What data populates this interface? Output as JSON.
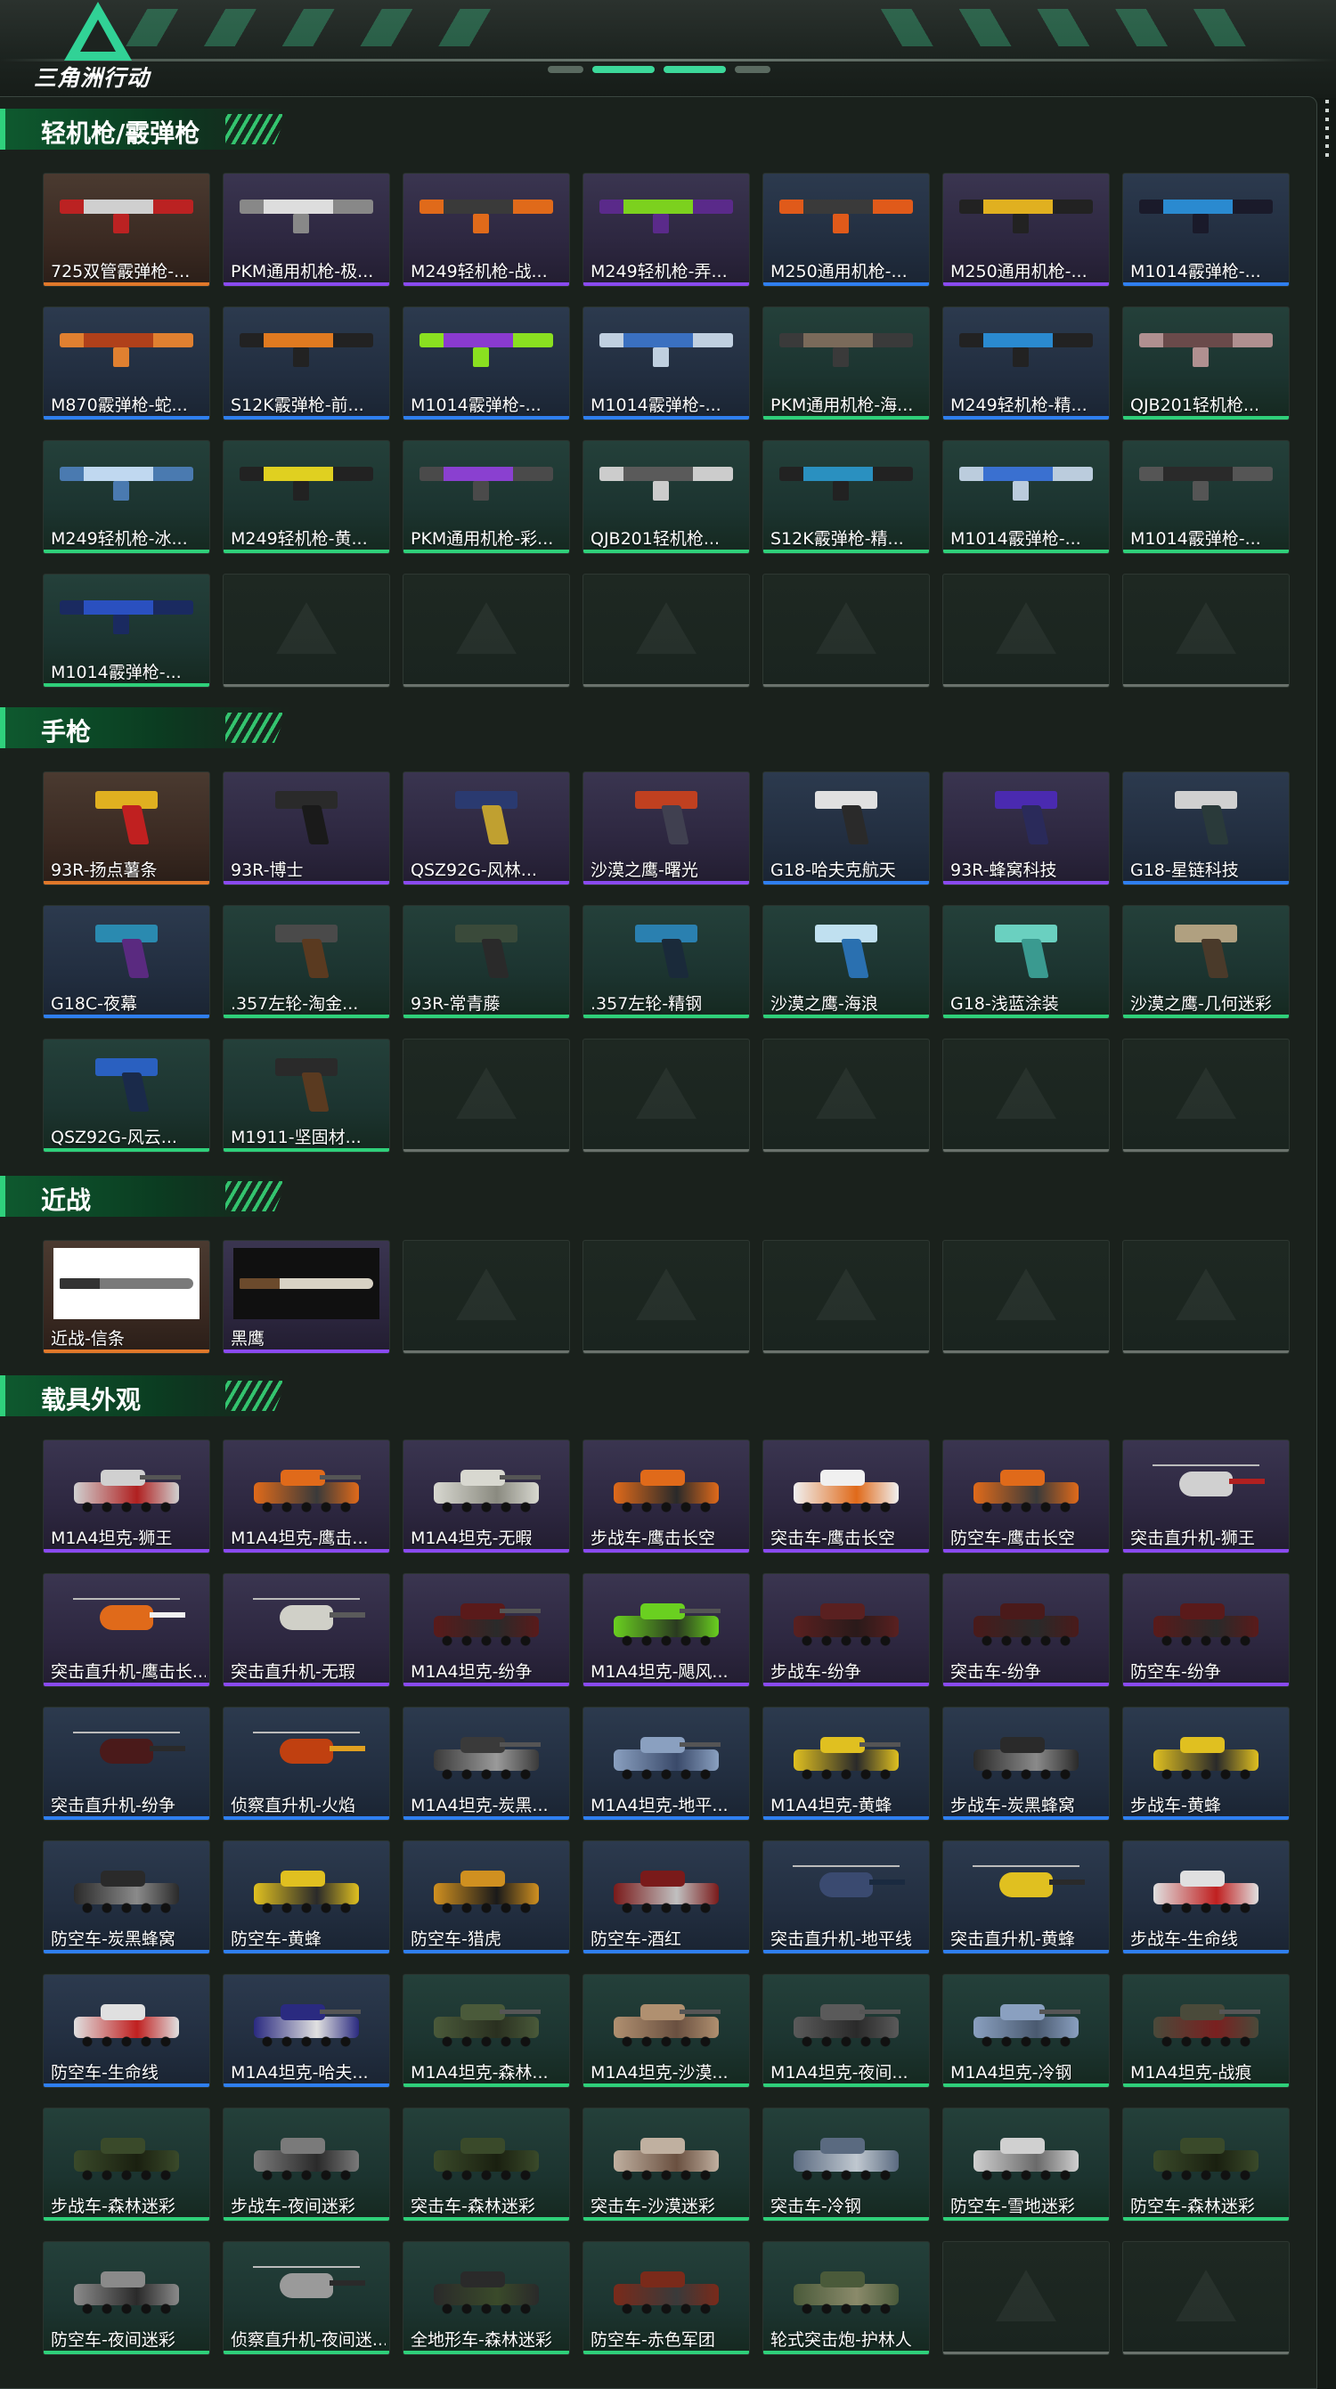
{
  "logo": {
    "text": "三角洲行动"
  },
  "sections": [
    {
      "title": "轻机枪/霰弹枪",
      "items": [
        {
          "label": "725双管霰弹枪-...",
          "quality": "orange",
          "kind": "gun",
          "c1": "#cfcfcf",
          "c2": "#b22"
        },
        {
          "label": "PKM通用机枪-极...",
          "quality": "purple",
          "kind": "gun",
          "c1": "#ddd",
          "c2": "#888"
        },
        {
          "label": "M249轻机枪-战...",
          "quality": "purple",
          "kind": "gun",
          "c1": "#3a3a3a",
          "c2": "#e06a1a"
        },
        {
          "label": "M249轻机枪-弄...",
          "quality": "purple",
          "kind": "gun",
          "c1": "#7cd11e",
          "c2": "#5a2a8a"
        },
        {
          "label": "M250通用机枪-...",
          "quality": "blue",
          "kind": "gun",
          "c1": "#3a3a3a",
          "c2": "#e05a1a"
        },
        {
          "label": "M250通用机枪-...",
          "quality": "purple",
          "kind": "gun",
          "c1": "#e0b020",
          "c2": "#222"
        },
        {
          "label": "M1014霰弹枪-...",
          "quality": "blue",
          "kind": "gun",
          "c1": "#2a8ad0",
          "c2": "#1a1a2a"
        },
        {
          "label": "M870霰弹枪-蛇...",
          "quality": "blue",
          "kind": "gun",
          "c1": "#b0401a",
          "c2": "#e08030"
        },
        {
          "label": "S12K霰弹枪-前...",
          "quality": "blue",
          "kind": "gun",
          "c1": "#e07a20",
          "c2": "#222"
        },
        {
          "label": "M1014霰弹枪-...",
          "quality": "blue",
          "kind": "gun",
          "c1": "#8a3ad0",
          "c2": "#8ae020"
        },
        {
          "label": "M1014霰弹枪-...",
          "quality": "blue",
          "kind": "gun",
          "c1": "#3a70c0",
          "c2": "#c0d0e0"
        },
        {
          "label": "PKM通用机枪-海...",
          "quality": "green",
          "kind": "gun",
          "c1": "#7a6a5a",
          "c2": "#3a3a3a"
        },
        {
          "label": "M249轻机枪-精...",
          "quality": "blue",
          "kind": "gun",
          "c1": "#2a8ad0",
          "c2": "#222"
        },
        {
          "label": "QJB201轻机枪...",
          "quality": "green",
          "kind": "gun",
          "c1": "#6a4a4a",
          "c2": "#b09090"
        },
        {
          "label": "M249轻机枪-冰...",
          "quality": "green",
          "kind": "gun",
          "c1": "#c0d8f0",
          "c2": "#4a7ab0"
        },
        {
          "label": "M249轻机枪-黄...",
          "quality": "green",
          "kind": "gun",
          "c1": "#e0d020",
          "c2": "#222"
        },
        {
          "label": "PKM通用机枪-彩...",
          "quality": "green",
          "kind": "gun",
          "c1": "#8a40d0",
          "c2": "#4a4a4a"
        },
        {
          "label": "QJB201轻机枪...",
          "quality": "green",
          "kind": "gun",
          "c1": "#5a5a5a",
          "c2": "#ccc"
        },
        {
          "label": "S12K霰弹枪-精...",
          "quality": "green",
          "kind": "gun",
          "c1": "#2a90c0",
          "c2": "#222"
        },
        {
          "label": "M1014霰弹枪-...",
          "quality": "green",
          "kind": "gun",
          "c1": "#3a70d0",
          "c2": "#bcd"
        },
        {
          "label": "M1014霰弹枪-...",
          "quality": "green",
          "kind": "gun",
          "c1": "#2a2a2a",
          "c2": "#555"
        },
        {
          "label": "M1014霰弹枪-...",
          "quality": "green",
          "kind": "gun",
          "c1": "#2a50c0",
          "c2": "#1a2a60"
        }
      ],
      "empty": 6
    },
    {
      "title": "手枪",
      "items": [
        {
          "label": "93R-扬点薯条",
          "quality": "orange",
          "kind": "pistol",
          "c1": "#e0b020",
          "c2": "#c02020"
        },
        {
          "label": "93R-博士",
          "quality": "purple",
          "kind": "pistol",
          "c1": "#2a2a2a",
          "c2": "#1a1a1a"
        },
        {
          "label": "QSZ92G-风林...",
          "quality": "purple",
          "kind": "pistol",
          "c1": "#2a3a70",
          "c2": "#c0a030"
        },
        {
          "label": "沙漠之鹰-曙光",
          "quality": "purple",
          "kind": "pistol",
          "c1": "#c04020",
          "c2": "#404050"
        },
        {
          "label": "G18-哈夫克航天",
          "quality": "blue",
          "kind": "pistol",
          "c1": "#e0e0e0",
          "c2": "#2a2a2a"
        },
        {
          "label": "93R-蜂窝科技",
          "quality": "purple",
          "kind": "pistol",
          "c1": "#4a2ab0",
          "c2": "#2a2a5a"
        },
        {
          "label": "G18-星链科技",
          "quality": "blue",
          "kind": "pistol",
          "c1": "#d0d0d0",
          "c2": "#2a3a3a"
        },
        {
          "label": "G18C-夜幕",
          "quality": "blue",
          "kind": "pistol",
          "c1": "#2a8ab0",
          "c2": "#5a2a80"
        },
        {
          "label": ".357左轮-淘金...",
          "quality": "green",
          "kind": "pistol",
          "c1": "#4a4a4a",
          "c2": "#5a3a20"
        },
        {
          "label": "93R-常青藤",
          "quality": "green",
          "kind": "pistol",
          "c1": "#3a4a3a",
          "c2": "#2a2a2a"
        },
        {
          "label": ".357左轮-精钢",
          "quality": "green",
          "kind": "pistol",
          "c1": "#2a80b0",
          "c2": "#1a2a3a"
        },
        {
          "label": "沙漠之鹰-海浪",
          "quality": "green",
          "kind": "pistol",
          "c1": "#c0e0f0",
          "c2": "#2a70b0"
        },
        {
          "label": "G18-浅蓝涂装",
          "quality": "green",
          "kind": "pistol",
          "c1": "#6ad0c0",
          "c2": "#3a9a90"
        },
        {
          "label": "沙漠之鹰-几何迷彩",
          "quality": "green",
          "kind": "pistol",
          "c1": "#b0a080",
          "c2": "#4a3a2a"
        },
        {
          "label": "QSZ92G-风云...",
          "quality": "green",
          "kind": "pistol",
          "c1": "#2a60c0",
          "c2": "#1a2a4a"
        },
        {
          "label": "M1911-坚固材...",
          "quality": "green",
          "kind": "pistol",
          "c1": "#2a2a2a",
          "c2": "#5a3a20"
        }
      ],
      "empty": 5
    },
    {
      "title": "近战",
      "items": [
        {
          "label": "近战-信条",
          "quality": "orange",
          "kind": "knife-white",
          "c1": "#555",
          "c2": "#b22"
        },
        {
          "label": "黑鹰",
          "quality": "purple",
          "kind": "knife",
          "c1": "#d8d2c4",
          "c2": "#6b4a2c"
        }
      ],
      "empty": 5
    },
    {
      "title": "载具外观",
      "items": [
        {
          "label": "M1A4坦克-狮王",
          "quality": "purple",
          "kind": "tank",
          "c1": "#d0d0d0",
          "c2": "#b02020"
        },
        {
          "label": "M1A4坦克-鹰击...",
          "quality": "purple",
          "kind": "tank",
          "c1": "#e06a1a",
          "c2": "#3a3a3a"
        },
        {
          "label": "M1A4坦克-无暇",
          "quality": "purple",
          "kind": "tank",
          "c1": "#d8d8d0",
          "c2": "#8a8a80"
        },
        {
          "label": "步战车-鹰击长空",
          "quality": "purple",
          "kind": "apc",
          "c1": "#e06a1a",
          "c2": "#2a2a2a"
        },
        {
          "label": "突击车-鹰击长空",
          "quality": "purple",
          "kind": "car",
          "c1": "#f0f0f0",
          "c2": "#e06a1a"
        },
        {
          "label": "防空车-鹰击长空",
          "quality": "purple",
          "kind": "apc",
          "c1": "#e06a1a",
          "c2": "#3a3a3a"
        },
        {
          "label": "突击直升机-狮王",
          "quality": "purple",
          "kind": "heli",
          "c1": "#d0d0d0",
          "c2": "#b02020"
        },
        {
          "label": "突击直升机-鹰击长...",
          "quality": "purple",
          "kind": "heli",
          "c1": "#e06a1a",
          "c2": "#f0f0f0"
        },
        {
          "label": "突击直升机-无瑕",
          "quality": "purple",
          "kind": "heli",
          "c1": "#d0d0c8",
          "c2": "#5a5a5a"
        },
        {
          "label": "M1A4坦克-纷争",
          "quality": "purple",
          "kind": "tank",
          "c1": "#5a1a1a",
          "c2": "#2a2a2a"
        },
        {
          "label": "M1A4坦克-飓风...",
          "quality": "purple",
          "kind": "tank",
          "c1": "#6ad020",
          "c2": "#2a3a20"
        },
        {
          "label": "步战车-纷争",
          "quality": "purple",
          "kind": "apc",
          "c1": "#5a2020",
          "c2": "#2a1a1a"
        },
        {
          "label": "突击车-纷争",
          "quality": "purple",
          "kind": "car",
          "c1": "#4a1a1a",
          "c2": "#2a2a2a"
        },
        {
          "label": "防空车-纷争",
          "quality": "purple",
          "kind": "apc",
          "c1": "#5a1a1a",
          "c2": "#2a2a2a"
        },
        {
          "label": "突击直升机-纷争",
          "quality": "blue",
          "kind": "heli",
          "c1": "#4a1a1a",
          "c2": "#2a2a2a"
        },
        {
          "label": "侦察直升机-火焰",
          "quality": "blue",
          "kind": "heli",
          "c1": "#c04010",
          "c2": "#e0a020"
        },
        {
          "label": "M1A4坦克-炭黑...",
          "quality": "blue",
          "kind": "tank",
          "c1": "#3a3a3a",
          "c2": "#9a9a9a"
        },
        {
          "label": "M1A4坦克-地平...",
          "quality": "blue",
          "kind": "tank",
          "c1": "#8aa0c0",
          "c2": "#3a4a6a"
        },
        {
          "label": "M1A4坦克-黄蜂",
          "quality": "blue",
          "kind": "tank",
          "c1": "#e0c020",
          "c2": "#2a2a2a"
        },
        {
          "label": "步战车-炭黑蜂窝",
          "quality": "blue",
          "kind": "apc",
          "c1": "#2a2a2a",
          "c2": "#8a8a8a"
        },
        {
          "label": "步战车-黄蜂",
          "quality": "blue",
          "kind": "apc",
          "c1": "#e0c020",
          "c2": "#2a2a2a"
        },
        {
          "label": "防空车-炭黑蜂窝",
          "quality": "blue",
          "kind": "apc",
          "c1": "#2a2a2a",
          "c2": "#8a8a8a"
        },
        {
          "label": "防空车-黄蜂",
          "quality": "blue",
          "kind": "apc",
          "c1": "#e0c020",
          "c2": "#2a2a2a"
        },
        {
          "label": "防空车-猎虎",
          "quality": "blue",
          "kind": "apc",
          "c1": "#d09020",
          "c2": "#1a1a1a"
        },
        {
          "label": "防空车-酒红",
          "quality": "blue",
          "kind": "apc",
          "c1": "#7a1a1a",
          "c2": "#c0c0c0"
        },
        {
          "label": "突击直升机-地平线",
          "quality": "blue",
          "kind": "heli",
          "c1": "#3a4a70",
          "c2": "#1a2a40"
        },
        {
          "label": "突击直升机-黄蜂",
          "quality": "blue",
          "kind": "heli",
          "c1": "#e0c020",
          "c2": "#2a2a2a"
        },
        {
          "label": "步战车-生命线",
          "quality": "blue",
          "kind": "apc",
          "c1": "#e0e0e0",
          "c2": "#c02020"
        },
        {
          "label": "防空车-生命线",
          "quality": "blue",
          "kind": "apc",
          "c1": "#e0e0e0",
          "c2": "#c02020"
        },
        {
          "label": "M1A4坦克-哈夫...",
          "quality": "blue",
          "kind": "tank",
          "c1": "#2a2a80",
          "c2": "#e0e0e0"
        },
        {
          "label": "M1A4坦克-森林...",
          "quality": "green",
          "kind": "tank",
          "c1": "#4a5a3a",
          "c2": "#2a3020"
        },
        {
          "label": "M1A4坦克-沙漠...",
          "quality": "green",
          "kind": "tank",
          "c1": "#b09070",
          "c2": "#6a5040"
        },
        {
          "label": "M1A4坦克-夜间...",
          "quality": "green",
          "kind": "tank",
          "c1": "#5a5a5a",
          "c2": "#2a2a2a"
        },
        {
          "label": "M1A4坦克-冷钢",
          "quality": "green",
          "kind": "tank",
          "c1": "#8aa0c0",
          "c2": "#4a5a70"
        },
        {
          "label": "M1A4坦克-战痕",
          "quality": "green",
          "kind": "tank",
          "c1": "#4a4a3a",
          "c2": "#7a2020"
        },
        {
          "label": "步战车-森林迷彩",
          "quality": "green",
          "kind": "apc",
          "c1": "#3a4a2a",
          "c2": "#1a2010"
        },
        {
          "label": "步战车-夜间迷彩",
          "quality": "green",
          "kind": "apc",
          "c1": "#7a7a7a",
          "c2": "#2a2a2a"
        },
        {
          "label": "突击车-森林迷彩",
          "quality": "green",
          "kind": "car",
          "c1": "#3a4a2a",
          "c2": "#1a2010"
        },
        {
          "label": "突击车-沙漠迷彩",
          "quality": "green",
          "kind": "car",
          "c1": "#c0b0a0",
          "c2": "#6a5040"
        },
        {
          "label": "突击车-冷钢",
          "quality": "green",
          "kind": "car",
          "c1": "#5a6a80",
          "c2": "#c0c8d0"
        },
        {
          "label": "防空车-雪地迷彩",
          "quality": "green",
          "kind": "apc",
          "c1": "#d0d0d0",
          "c2": "#6a6a6a"
        },
        {
          "label": "防空车-森林迷彩",
          "quality": "green",
          "kind": "apc",
          "c1": "#3a4a2a",
          "c2": "#1a2010"
        },
        {
          "label": "防空车-夜间迷彩",
          "quality": "green",
          "kind": "apc",
          "c1": "#8a8a8a",
          "c2": "#2a2a2a"
        },
        {
          "label": "侦察直升机-夜间迷...",
          "quality": "green",
          "kind": "heli",
          "c1": "#9a9a9a",
          "c2": "#2a2a2a"
        },
        {
          "label": "全地形车-森林迷彩",
          "quality": "green",
          "kind": "car",
          "c1": "#2a2a2a",
          "c2": "#3a4a2a"
        },
        {
          "label": "防空车-赤色军团",
          "quality": "green",
          "kind": "apc",
          "c1": "#7a2a1a",
          "c2": "#3a3a3a"
        },
        {
          "label": "轮式突击炮-护林人",
          "quality": "green",
          "kind": "apc",
          "c1": "#4a5a3a",
          "c2": "#8a8a6a"
        }
      ],
      "empty": 2
    }
  ]
}
